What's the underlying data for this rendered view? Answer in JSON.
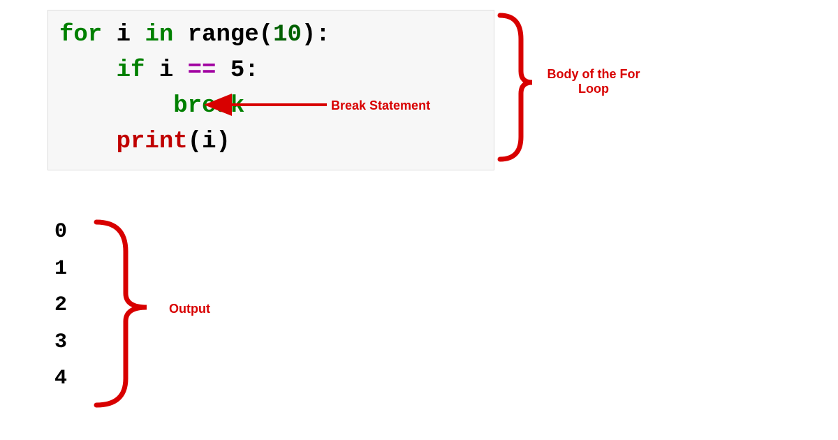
{
  "code": {
    "line1": {
      "kw_for": "for",
      "var_i": " i ",
      "kw_in": "in",
      "fn_range": " range",
      "paren_open": "(",
      "arg": "10",
      "paren_close_colon": "):"
    },
    "line2": {
      "indent": "    ",
      "kw_if": "if",
      "cond_left": " i ",
      "op_eq": "==",
      "cond_right": " 5",
      "colon": ":"
    },
    "line3": {
      "indent": "        ",
      "kw_break": "break"
    },
    "line4": {
      "indent": "    ",
      "fn_print": "print",
      "paren_open": "(",
      "arg": "i",
      "paren_close": ")"
    }
  },
  "output": {
    "lines": [
      "0",
      "1",
      "2",
      "3",
      "4"
    ]
  },
  "annotations": {
    "break_statement": "Break Statement",
    "body_of_for_loop_a": "Body of the For",
    "body_of_for_loop_b": "Loop",
    "output_label": "Output"
  }
}
